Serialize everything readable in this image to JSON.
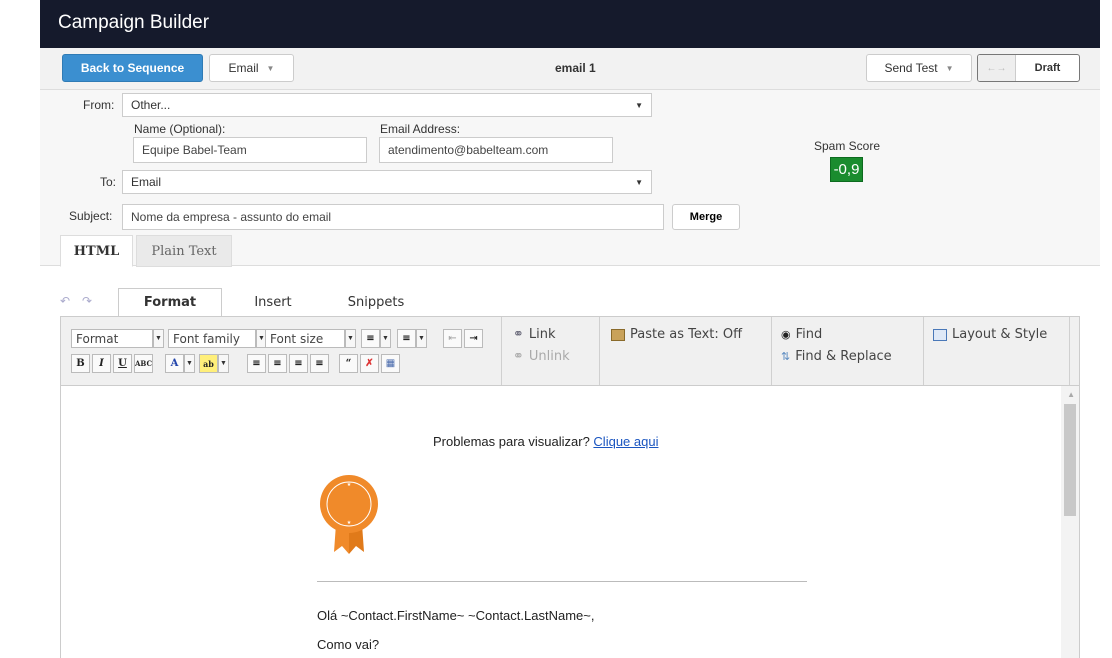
{
  "app": {
    "title": "Campaign Builder"
  },
  "toolbar": {
    "back_label": "Back to Sequence",
    "type_label": "Email",
    "email_name": "email 1",
    "send_test_label": "Send Test",
    "toggle_off_label": "←→",
    "status_label": "Draft"
  },
  "form": {
    "from_label": "From:",
    "from_value": "Other...",
    "name_label": "Name (Optional):",
    "name_value": "Equipe Babel-Team",
    "email_label": "Email Address:",
    "email_value": "atendimento@babelteam.com",
    "to_label": "To:",
    "to_value": "Email",
    "subject_label": "Subject:",
    "subject_value": "Nome da empresa - assunto do email",
    "merge_label": "Merge",
    "spam_label": "Spam Score",
    "spam_value": "-0,9"
  },
  "content_tabs": [
    {
      "label": "HTML",
      "active": true
    },
    {
      "label": "Plain Text",
      "active": false
    }
  ],
  "editor": {
    "tabs": [
      "Format",
      "Insert",
      "Snippets"
    ],
    "format_select": "Format",
    "font_family_select": "Font family",
    "font_size_select": "Font size",
    "link_label": "Link",
    "unlink_label": "Unlink",
    "paste_label": "Paste as Text: Off",
    "find_label": "Find",
    "find_replace_label": "Find & Replace",
    "layout_label": "Layout & Style"
  },
  "email_body": {
    "preview_text": "Problemas para visualizar?",
    "preview_link": "Clique aqui",
    "greeting": "Olá ~Contact.FirstName~ ~Contact.LastName~,",
    "line2": "Como vai?"
  },
  "colors": {
    "titlebar": "#151a2c",
    "primary": "#3b8fd0",
    "spam_badge": "#1a8c2e",
    "logo_orange": "#f08a2a"
  }
}
